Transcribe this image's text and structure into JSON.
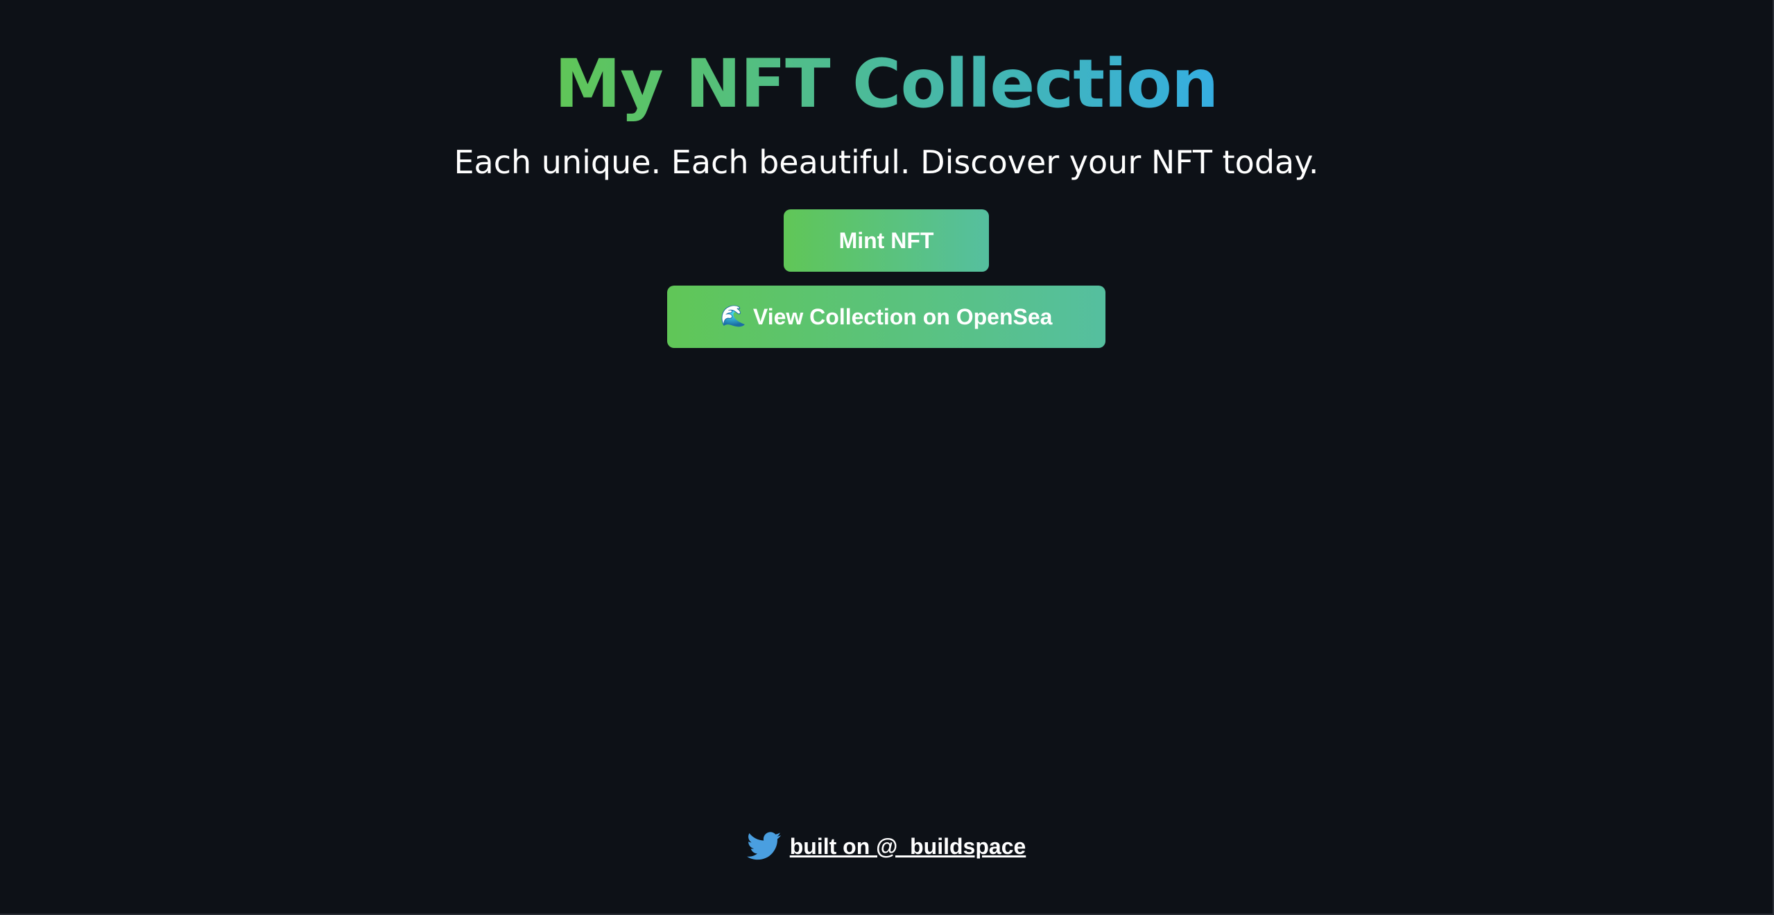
{
  "header": {
    "title": "My NFT Collection",
    "subtitle": "Each unique. Each beautiful. Discover your NFT today."
  },
  "actions": {
    "mint_label": "Mint NFT",
    "opensea_icon": "🌊",
    "opensea_label": "View Collection on OpenSea"
  },
  "footer": {
    "icon": "twitter-icon",
    "link_text": "built on @_buildspace"
  },
  "colors": {
    "background": "#0d1117",
    "gradient_start": "#60c657",
    "gradient_end": "#35aee2",
    "twitter_blue": "#4a9fe0",
    "text": "#ffffff"
  }
}
